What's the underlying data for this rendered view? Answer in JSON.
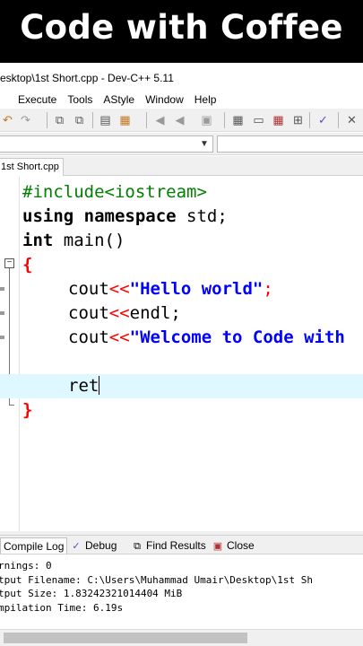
{
  "banner": {
    "title": "Code with Coffee"
  },
  "window": {
    "title": "esktop\\1st Short.cpp - Dev-C++ 5.11"
  },
  "menu": {
    "items": [
      "",
      "Execute",
      "Tools",
      "AStyle",
      "Window",
      "Help"
    ]
  },
  "tab": {
    "label": "1st Short.cpp"
  },
  "code": {
    "line1": "#include<iostream>",
    "line2_kw1": "using",
    "line2_kw2": "namespace",
    "line2_rest": " std;",
    "line3_kw": "int",
    "line3_rest": " main()",
    "open_brace": "{",
    "cout": "cout",
    "shift_op": "<<",
    "hello_str": "\"Hello world\"",
    "semicolon": ";",
    "endl_rest": "endl;",
    "welcome_str": "\"Welcome to Code with",
    "ret": "ret",
    "close_brace": "}"
  },
  "bottom_tabs": {
    "compile_log": "Compile Log",
    "debug": "Debug",
    "find_results": "Find Results",
    "close": "Close"
  },
  "log": {
    "lines": [
      "rnings: 0",
      "tput Filename: C:\\Users\\Muhammad Umair\\Desktop\\1st Sh",
      "tput Size: 1.83242321014404 MiB",
      "mpilation Time: 6.19s"
    ]
  }
}
